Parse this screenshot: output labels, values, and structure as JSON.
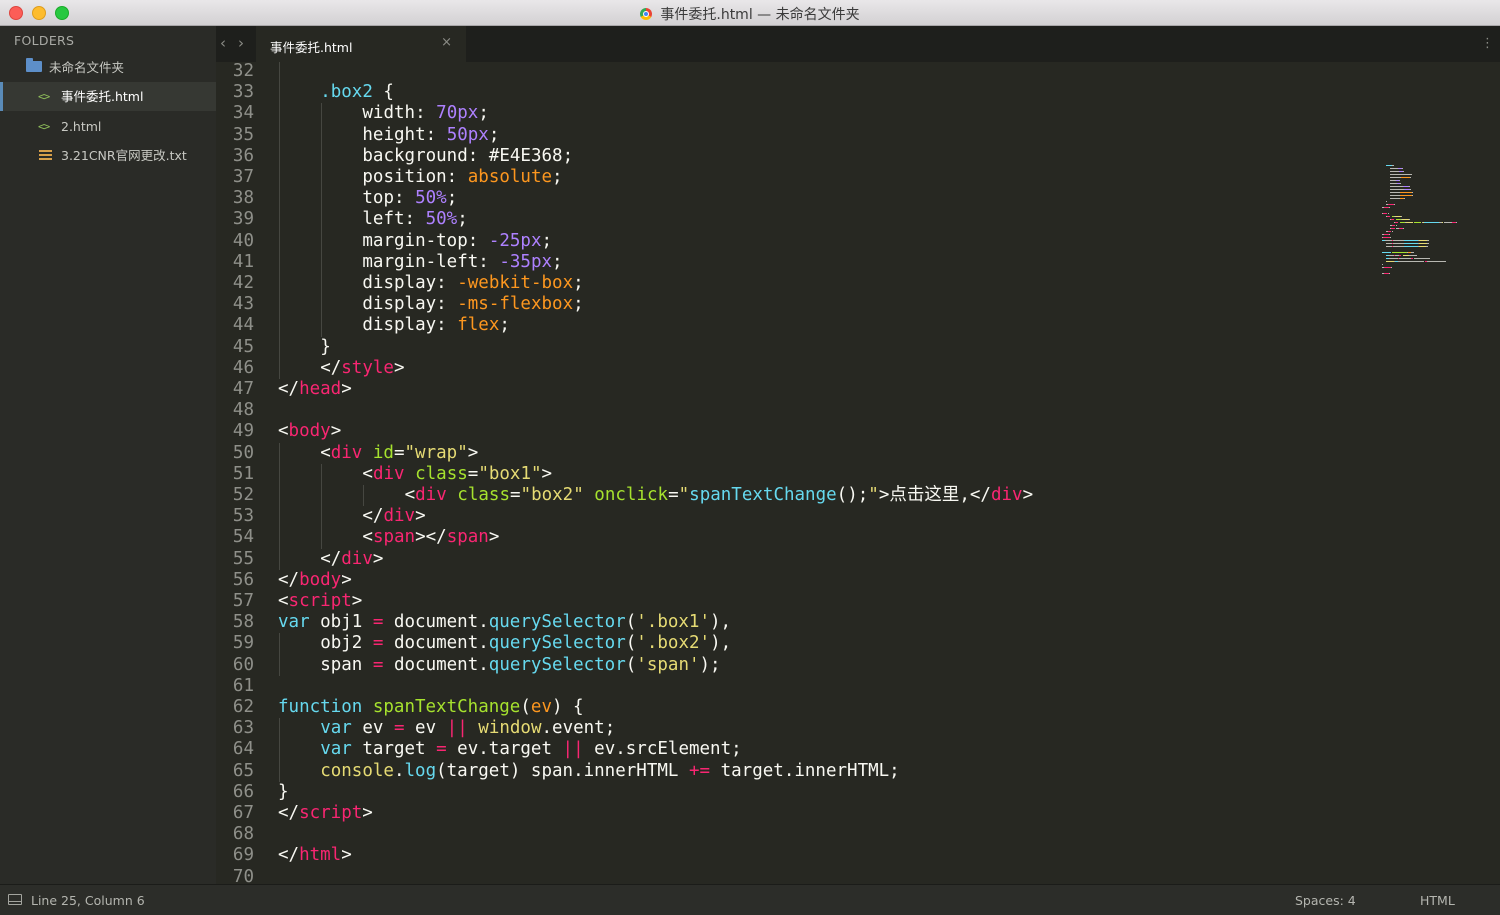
{
  "window": {
    "title": "事件委托.html — 未命名文件夹"
  },
  "sidebar": {
    "header": "FOLDERS",
    "items": [
      {
        "label": "未命名文件夹",
        "icon": "folder-icon",
        "active": false
      },
      {
        "label": "事件委托.html",
        "icon": "code-file-icon",
        "active": true
      },
      {
        "label": "2.html",
        "icon": "code-file-icon",
        "active": false
      },
      {
        "label": "3.21CNR官网更改.txt",
        "icon": "text-file-icon",
        "active": false
      }
    ]
  },
  "tabs": [
    {
      "label": "事件委托.html",
      "active": true
    }
  ],
  "editor": {
    "first_line_number": 32,
    "lines": [
      {
        "n": "32",
        "indent": 1,
        "tokens": []
      },
      {
        "n": "33",
        "indent": 1,
        "tokens": [
          [
            "p",
            ".box2"
          ],
          [
            "w",
            " {"
          ]
        ]
      },
      {
        "n": "34",
        "indent": 2,
        "tokens": [
          [
            "w",
            "width: "
          ],
          [
            "n",
            "70px"
          ],
          [
            "w",
            ";"
          ]
        ]
      },
      {
        "n": "35",
        "indent": 2,
        "tokens": [
          [
            "w",
            "height: "
          ],
          [
            "n",
            "50px"
          ],
          [
            "w",
            ";"
          ]
        ]
      },
      {
        "n": "36",
        "indent": 2,
        "tokens": [
          [
            "w",
            "background: #E4E368;"
          ]
        ]
      },
      {
        "n": "37",
        "indent": 2,
        "tokens": [
          [
            "w",
            "position: "
          ],
          [
            "c",
            "absolute"
          ],
          [
            "w",
            ";"
          ]
        ]
      },
      {
        "n": "38",
        "indent": 2,
        "tokens": [
          [
            "w",
            "top: "
          ],
          [
            "n",
            "50%"
          ],
          [
            "w",
            ";"
          ]
        ]
      },
      {
        "n": "39",
        "indent": 2,
        "tokens": [
          [
            "w",
            "left: "
          ],
          [
            "n",
            "50%"
          ],
          [
            "w",
            ";"
          ]
        ]
      },
      {
        "n": "40",
        "indent": 2,
        "tokens": [
          [
            "w",
            "margin-top: "
          ],
          [
            "n",
            "-25px"
          ],
          [
            "w",
            ";"
          ]
        ]
      },
      {
        "n": "41",
        "indent": 2,
        "tokens": [
          [
            "w",
            "margin-left: "
          ],
          [
            "n",
            "-35px"
          ],
          [
            "w",
            ";"
          ]
        ]
      },
      {
        "n": "42",
        "indent": 2,
        "tokens": [
          [
            "w",
            "display: "
          ],
          [
            "c",
            "-webkit-box"
          ],
          [
            "w",
            ";"
          ]
        ]
      },
      {
        "n": "43",
        "indent": 2,
        "tokens": [
          [
            "w",
            "display: "
          ],
          [
            "c",
            "-ms-flexbox"
          ],
          [
            "w",
            ";"
          ]
        ]
      },
      {
        "n": "44",
        "indent": 2,
        "tokens": [
          [
            "w",
            "display: "
          ],
          [
            "c",
            "flex"
          ],
          [
            "w",
            ";"
          ]
        ]
      },
      {
        "n": "45",
        "indent": 1,
        "tokens": [
          [
            "w",
            "}"
          ]
        ]
      },
      {
        "n": "46",
        "indent": 1,
        "tokens": [
          [
            "w",
            "</"
          ],
          [
            "t",
            "style"
          ],
          [
            "w",
            ">"
          ]
        ]
      },
      {
        "n": "47",
        "indent": 0,
        "tokens": [
          [
            "w",
            "</"
          ],
          [
            "t",
            "head"
          ],
          [
            "w",
            ">"
          ]
        ]
      },
      {
        "n": "48",
        "indent": 0,
        "tokens": []
      },
      {
        "n": "49",
        "indent": 0,
        "tokens": [
          [
            "w",
            "<"
          ],
          [
            "t",
            "body"
          ],
          [
            "w",
            ">"
          ]
        ]
      },
      {
        "n": "50",
        "indent": 1,
        "tokens": [
          [
            "w",
            "<"
          ],
          [
            "t",
            "div"
          ],
          [
            "w",
            " "
          ],
          [
            "a",
            "id"
          ],
          [
            "w",
            "="
          ],
          [
            "s",
            "\"wrap\""
          ],
          [
            "w",
            ">"
          ]
        ]
      },
      {
        "n": "51",
        "indent": 2,
        "tokens": [
          [
            "w",
            "<"
          ],
          [
            "t",
            "div"
          ],
          [
            "w",
            " "
          ],
          [
            "a",
            "class"
          ],
          [
            "w",
            "="
          ],
          [
            "s",
            "\"box1\""
          ],
          [
            "w",
            ">"
          ]
        ]
      },
      {
        "n": "52",
        "indent": 3,
        "tokens": [
          [
            "w",
            "<"
          ],
          [
            "t",
            "div"
          ],
          [
            "w",
            " "
          ],
          [
            "a",
            "class"
          ],
          [
            "w",
            "="
          ],
          [
            "s",
            "\"box2\""
          ],
          [
            "w",
            " "
          ],
          [
            "a",
            "onclick"
          ],
          [
            "w",
            "="
          ],
          [
            "s",
            "\""
          ],
          [
            "p",
            "spanTextChange"
          ],
          [
            "w",
            "();"
          ],
          [
            "s",
            "\""
          ],
          [
            "w",
            ">点击这里,</"
          ],
          [
            "t",
            "div"
          ],
          [
            "w",
            ">"
          ]
        ]
      },
      {
        "n": "53",
        "indent": 2,
        "tokens": [
          [
            "w",
            "</"
          ],
          [
            "t",
            "div"
          ],
          [
            "w",
            ">"
          ]
        ]
      },
      {
        "n": "54",
        "indent": 2,
        "tokens": [
          [
            "w",
            "<"
          ],
          [
            "t",
            "span"
          ],
          [
            "w",
            "></"
          ],
          [
            "t",
            "span"
          ],
          [
            "w",
            ">"
          ]
        ]
      },
      {
        "n": "55",
        "indent": 1,
        "tokens": [
          [
            "w",
            "</"
          ],
          [
            "t",
            "div"
          ],
          [
            "w",
            ">"
          ]
        ]
      },
      {
        "n": "56",
        "indent": 0,
        "tokens": [
          [
            "w",
            "</"
          ],
          [
            "t",
            "body"
          ],
          [
            "w",
            ">"
          ]
        ]
      },
      {
        "n": "57",
        "indent": 0,
        "tokens": [
          [
            "w",
            "<"
          ],
          [
            "t",
            "script"
          ],
          [
            "w",
            ">"
          ]
        ]
      },
      {
        "n": "58",
        "indent": 0,
        "tokens": [
          [
            "k",
            "var"
          ],
          [
            "w",
            " obj1 "
          ],
          [
            "t",
            "="
          ],
          [
            "w",
            " document."
          ],
          [
            "p",
            "querySelector"
          ],
          [
            "w",
            "("
          ],
          [
            "s",
            "'.box1'"
          ],
          [
            "w",
            "),"
          ]
        ]
      },
      {
        "n": "59",
        "indent": 1,
        "tokens": [
          [
            "w",
            "obj2 "
          ],
          [
            "t",
            "="
          ],
          [
            "w",
            " document."
          ],
          [
            "p",
            "querySelector"
          ],
          [
            "w",
            "("
          ],
          [
            "s",
            "'.box2'"
          ],
          [
            "w",
            "),"
          ]
        ]
      },
      {
        "n": "60",
        "indent": 1,
        "tokens": [
          [
            "w",
            "span "
          ],
          [
            "t",
            "="
          ],
          [
            "w",
            " document."
          ],
          [
            "p",
            "querySelector"
          ],
          [
            "w",
            "("
          ],
          [
            "s",
            "'span'"
          ],
          [
            "w",
            ");"
          ]
        ]
      },
      {
        "n": "61",
        "indent": 0,
        "tokens": []
      },
      {
        "n": "62",
        "indent": 0,
        "tokens": [
          [
            "k",
            "function"
          ],
          [
            "w",
            " "
          ],
          [
            "f",
            "spanTextChange"
          ],
          [
            "w",
            "("
          ],
          [
            "c",
            "ev"
          ],
          [
            "w",
            ") {"
          ]
        ]
      },
      {
        "n": "63",
        "indent": 1,
        "tokens": [
          [
            "k",
            "var"
          ],
          [
            "w",
            " ev "
          ],
          [
            "t",
            "="
          ],
          [
            "w",
            " ev "
          ],
          [
            "t",
            "||"
          ],
          [
            "w",
            " "
          ],
          [
            "s",
            "window"
          ],
          [
            "w",
            ".event;"
          ]
        ]
      },
      {
        "n": "64",
        "indent": 1,
        "tokens": [
          [
            "k",
            "var"
          ],
          [
            "w",
            " target "
          ],
          [
            "t",
            "="
          ],
          [
            "w",
            " ev.target "
          ],
          [
            "t",
            "||"
          ],
          [
            "w",
            " ev.srcElement;"
          ]
        ]
      },
      {
        "n": "65",
        "indent": 1,
        "tokens": [
          [
            "s",
            "console"
          ],
          [
            "w",
            "."
          ],
          [
            "p",
            "log"
          ],
          [
            "w",
            "(target) span.innerHTML "
          ],
          [
            "t",
            "+="
          ],
          [
            "w",
            " target.innerHTML;"
          ]
        ]
      },
      {
        "n": "66",
        "indent": 0,
        "tokens": [
          [
            "w",
            "}"
          ]
        ]
      },
      {
        "n": "67",
        "indent": 0,
        "tokens": [
          [
            "w",
            "</"
          ],
          [
            "t",
            "script"
          ],
          [
            "w",
            ">"
          ]
        ]
      },
      {
        "n": "68",
        "indent": 0,
        "tokens": []
      },
      {
        "n": "69",
        "indent": 0,
        "tokens": [
          [
            "w",
            "</"
          ],
          [
            "t",
            "html"
          ],
          [
            "w",
            ">"
          ]
        ]
      },
      {
        "n": "70",
        "indent": 0,
        "tokens": []
      }
    ]
  },
  "statusbar": {
    "position": "Line 25, Column 6",
    "spaces": "Spaces: 4",
    "syntax": "HTML"
  },
  "colors": {
    "background": "#272822",
    "tag": "#f92672",
    "attribute": "#a6e22e",
    "string": "#e6db74",
    "number": "#ae81ff",
    "keyword": "#66d9ef",
    "constant": "#fd971f"
  }
}
